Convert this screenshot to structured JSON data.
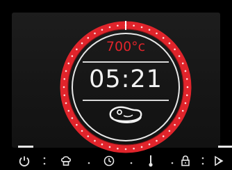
{
  "display": {
    "temperature": "700°c",
    "timer": "05:21",
    "program_icon": "steak-icon",
    "accent_color": "#e0242b"
  },
  "controls": [
    {
      "name": "power-icon"
    },
    {
      "name": "chef-hat-icon"
    },
    {
      "name": "clock-icon"
    },
    {
      "name": "thermometer-icon"
    },
    {
      "name": "lock-icon"
    },
    {
      "name": "next-icon"
    }
  ]
}
